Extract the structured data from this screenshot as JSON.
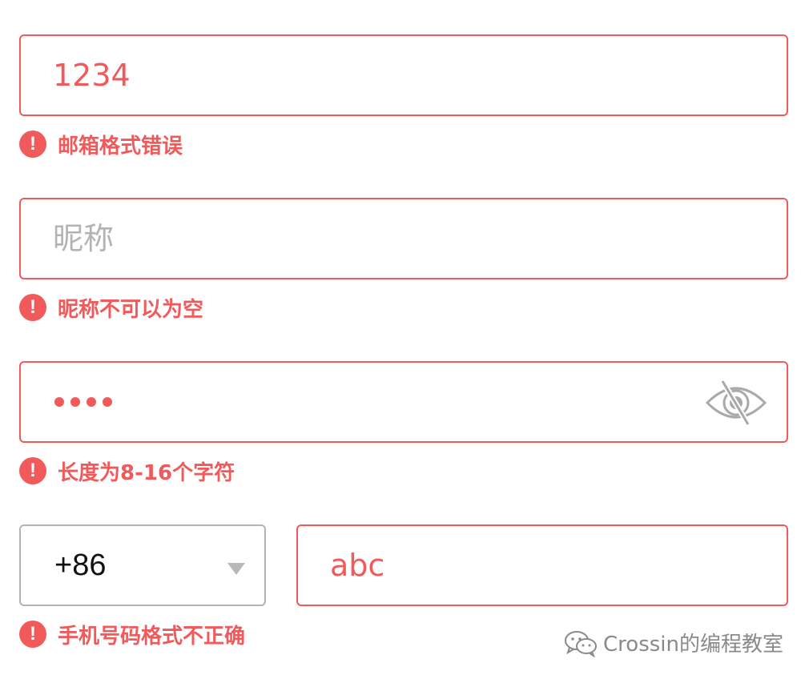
{
  "email": {
    "value": "1234",
    "error": "邮箱格式错误",
    "state": "error"
  },
  "nickname": {
    "value": "",
    "placeholder": "昵称",
    "error": "昵称不可以为空",
    "state": "error"
  },
  "password": {
    "masked_length": 4,
    "visibility_icon": "eye-slash-icon",
    "error": "长度为8-16个字符",
    "state": "error"
  },
  "phone": {
    "country_code": "+86",
    "value": "abc",
    "error": "手机号码格式不正确",
    "state": "error"
  },
  "watermark": {
    "text": "Crossin的编程教室"
  },
  "colors": {
    "error": "#f15a5a",
    "placeholder": "#b3b3b3",
    "neutral_border": "#b3b3b3",
    "icon_gray": "#aaaaaa",
    "text": "#111111"
  },
  "icons": {
    "error": "exclamation-circle-icon",
    "dropdown": "caret-down-icon",
    "watermark": "wechat-icon"
  }
}
